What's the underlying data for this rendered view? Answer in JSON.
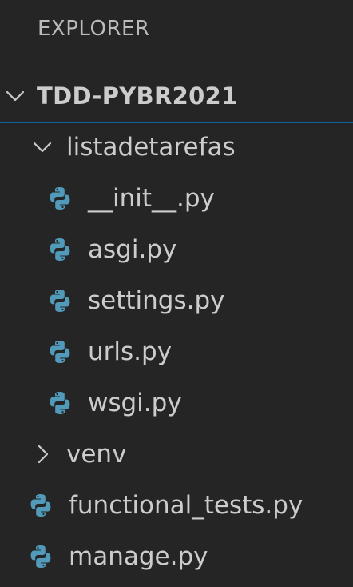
{
  "panel": {
    "title": "EXPLORER"
  },
  "tree": {
    "root": {
      "label": "TDD-PYBR2021",
      "expanded": true
    },
    "folder_listadetarefas": {
      "label": "listadetarefas",
      "expanded": true,
      "files": [
        {
          "label": "__init__.py",
          "icon": "python-icon"
        },
        {
          "label": "asgi.py",
          "icon": "python-icon"
        },
        {
          "label": "settings.py",
          "icon": "python-icon"
        },
        {
          "label": "urls.py",
          "icon": "python-icon"
        },
        {
          "label": "wsgi.py",
          "icon": "python-icon"
        }
      ]
    },
    "folder_venv": {
      "label": "venv",
      "expanded": false
    },
    "root_files": [
      {
        "label": "functional_tests.py",
        "icon": "python-icon"
      },
      {
        "label": "manage.py",
        "icon": "python-icon"
      }
    ]
  },
  "colors": {
    "background": "#252526",
    "text": "#cccccc",
    "focus_border": "#0e639c",
    "python_icon": "#519aba"
  }
}
